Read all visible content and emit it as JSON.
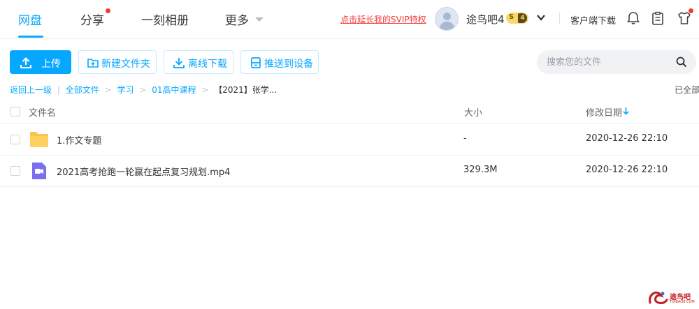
{
  "nav": {
    "items": [
      {
        "label": "网盘",
        "active": true
      },
      {
        "label": "分享",
        "has_dot": true
      },
      {
        "label": "一刻相册"
      },
      {
        "label": "更多"
      }
    ],
    "svip_promo": "点击延长我的SVIP特权",
    "username": "途鸟吧4",
    "level_s": "S",
    "level_num": "4",
    "client_download": "客户端下载",
    "icons": [
      "bell-icon",
      "clipboard-icon",
      "shirt-icon"
    ]
  },
  "toolbar": {
    "upload": "上传",
    "new_folder": "新建文件夹",
    "offline_download": "离线下载",
    "push_device": "推送到设备"
  },
  "search": {
    "placeholder": "搜索您的文件"
  },
  "breadcrumb": {
    "back": "返回上一级",
    "sep": "|",
    "items": [
      "全部文件",
      "学习",
      "01高中课程"
    ],
    "arrow": ">",
    "current": "【2021】张学..."
  },
  "status": {
    "loaded": "已全部"
  },
  "table": {
    "columns": {
      "name": "文件名",
      "size": "大小",
      "date": "修改日期"
    },
    "rows": [
      {
        "name": "1.作文专题",
        "size": "-",
        "date": "2020-12-26 22:10",
        "type": "folder"
      },
      {
        "name": "2021高考抢跑一轮赢在起点复习规划.mp4",
        "size": "329.3M",
        "date": "2020-12-26 22:10",
        "type": "video"
      }
    ]
  },
  "watermark": {
    "text": "途鸟吧",
    "sub": "TUNIAO8.COM"
  },
  "colors": {
    "accent": "#06a7ff",
    "promo_red": "#f33b3b",
    "folder": "#fcc54a",
    "video": "#7c6ef2"
  }
}
